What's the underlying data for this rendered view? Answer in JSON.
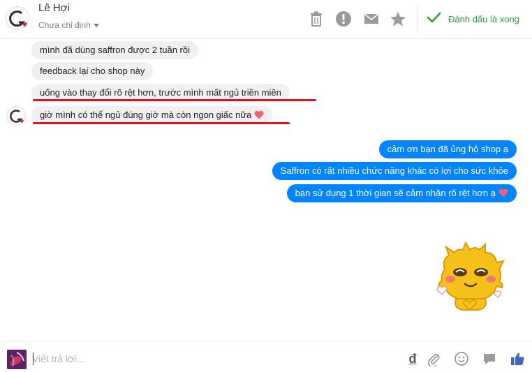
{
  "header": {
    "contact_name": "Lê Hợi",
    "assign_label": "Chưa chỉ định",
    "done_label": "Đánh dấu là xong",
    "icons": [
      "trash-icon",
      "alert-icon",
      "mail-icon",
      "star-icon",
      "check-icon"
    ]
  },
  "messages": {
    "incoming": [
      {
        "text": "mình đã dùng saffron được 2 tuần rồi",
        "underlined": false,
        "heart": false
      },
      {
        "text": "feedback lại cho shop này",
        "underlined": false,
        "heart": false
      },
      {
        "text": "uống vào thay đổi rõ rệt hơn, trước mình mất ngủ triền miên",
        "underlined": true,
        "heart": false
      },
      {
        "text": "giờ mình có thể ngủ đúng giờ mà còn ngon giấc nữa",
        "underlined": true,
        "heart": true
      }
    ],
    "outgoing": [
      {
        "text": "cảm ơn bạn đã ủng hộ shop ạ",
        "heart": false
      },
      {
        "text": "Saffron có rất nhiều chức năng khác có lợi cho sức khỏe",
        "heart": false
      },
      {
        "text": "bạn sử dụng 1 thời gian sẽ cảm nhận rõ rệt hơn ạ",
        "heart": true
      }
    ],
    "sticker": "sticker-character-hearts"
  },
  "composer": {
    "placeholder": "Viết trả lời...",
    "currency_symbol": "đ",
    "icons": [
      "currency-icon",
      "attach-icon",
      "emoji-icon",
      "chat-bubble-icon",
      "like-icon"
    ]
  },
  "colors": {
    "outgoing_bubble": "#0084ff",
    "incoming_bubble": "#f1f0f0",
    "done_green": "#2a9d3d",
    "underline_red": "#e0141e",
    "like_blue": "#4267b2"
  }
}
